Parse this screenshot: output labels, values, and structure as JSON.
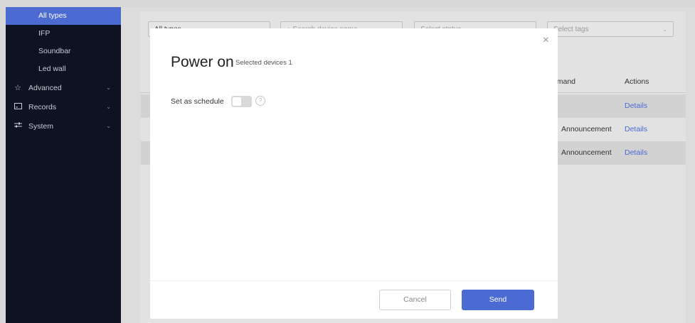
{
  "sidebar": {
    "sub_items": [
      {
        "label": "All types",
        "active": true
      },
      {
        "label": "IFP",
        "active": false
      },
      {
        "label": "Soundbar",
        "active": false
      },
      {
        "label": "Led wall",
        "active": false
      }
    ],
    "groups": [
      {
        "label": "Advanced",
        "icon": "star-icon"
      },
      {
        "label": "Records",
        "icon": "records-icon"
      },
      {
        "label": "System",
        "icon": "sliders-icon"
      }
    ]
  },
  "filters": {
    "type_value": "All types",
    "search_placeholder": "Search device name",
    "status_placeholder": "Select status",
    "tags_placeholder": "Select tags"
  },
  "table": {
    "headers": {
      "command": "mmand",
      "actions": "Actions"
    },
    "rows": [
      {
        "command": "",
        "action": "Details"
      },
      {
        "command": "Announcement",
        "action": "Details"
      },
      {
        "command": "Announcement",
        "action": "Details"
      }
    ]
  },
  "modal": {
    "title": "Power on",
    "subtitle": "Selected devices 1",
    "schedule_label": "Set as schedule",
    "schedule_enabled": false,
    "close_glyph": "×",
    "help_glyph": "?",
    "cancel_label": "Cancel",
    "send_label": "Send"
  },
  "colors": {
    "accent": "#4c6bd2",
    "sidebar_bg": "#0e1323"
  }
}
